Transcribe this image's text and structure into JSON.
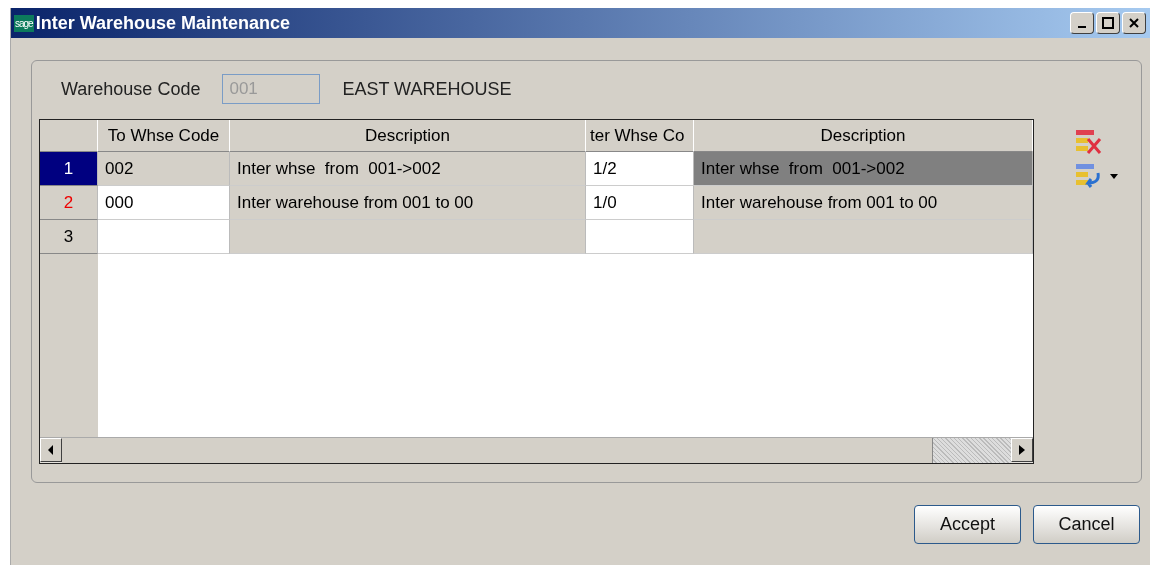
{
  "window": {
    "title": "Inter Warehouse Maintenance",
    "logo": "sage"
  },
  "warehouse": {
    "label": "Warehouse Code",
    "value": "001",
    "name": "EAST WAREHOUSE"
  },
  "grid": {
    "columns": [
      "To Whse Code",
      "Description",
      "ter Whse Co",
      "Description"
    ],
    "rows": [
      {
        "number": "1",
        "selected": true,
        "modified": false,
        "cells": [
          {
            "text": "002",
            "editable": false,
            "highlighted": false
          },
          {
            "text": "Inter whse  from  001->002",
            "editable": false,
            "highlighted": false
          },
          {
            "text": "1/2",
            "editable": true,
            "highlighted": false
          },
          {
            "text": "Inter whse  from  001->002",
            "editable": false,
            "highlighted": true
          }
        ]
      },
      {
        "number": "2",
        "selected": false,
        "modified": true,
        "cells": [
          {
            "text": "000",
            "editable": true,
            "highlighted": false
          },
          {
            "text": "Inter warehouse from 001 to 00",
            "editable": false,
            "highlighted": false
          },
          {
            "text": "1/0",
            "editable": true,
            "highlighted": false
          },
          {
            "text": "Inter warehouse from 001 to 00",
            "editable": false,
            "highlighted": false
          }
        ]
      },
      {
        "number": "3",
        "selected": false,
        "modified": false,
        "cells": [
          {
            "editable": true,
            "highlighted": false
          },
          {
            "editable": false,
            "highlighted": false
          },
          {
            "editable": true,
            "highlighted": false
          },
          {
            "editable": false,
            "highlighted": false
          }
        ]
      }
    ]
  },
  "buttons": [
    "Accept",
    "Cancel"
  ]
}
